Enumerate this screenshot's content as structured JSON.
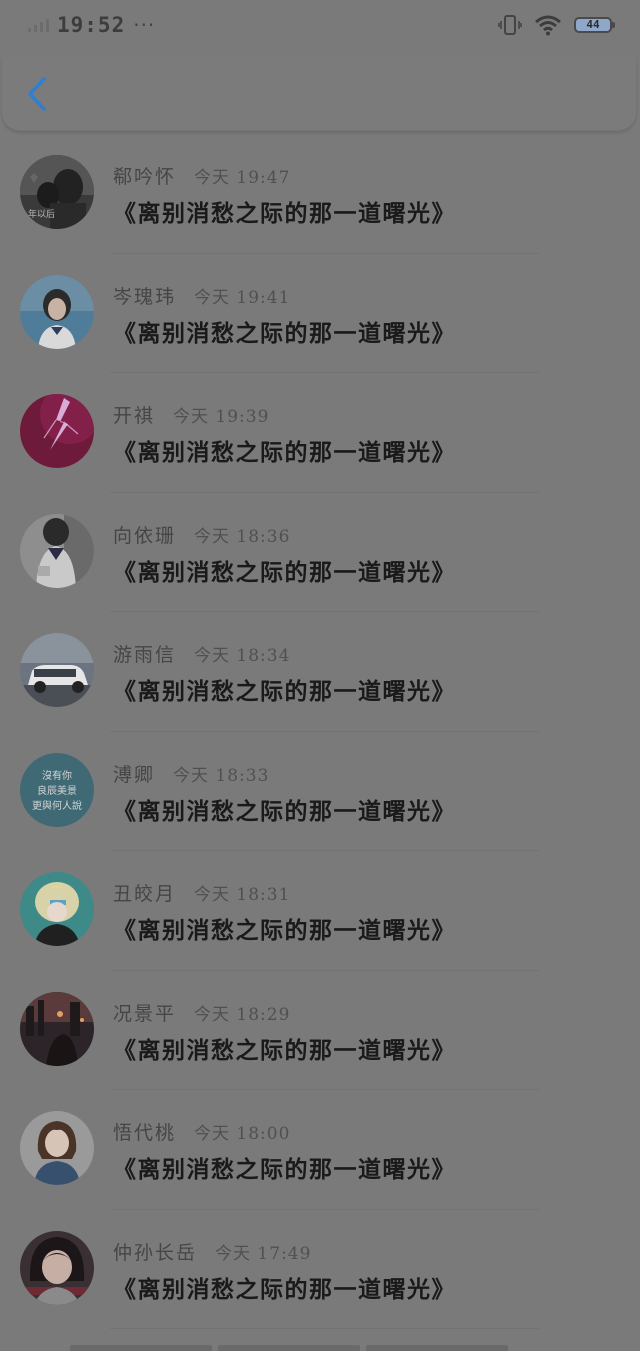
{
  "status_bar": {
    "time": "19:52",
    "more_dots": "···",
    "battery_level": "44"
  },
  "header": {
    "back_icon": "chevron-left-icon",
    "accent_color": "#2f7fd0"
  },
  "messages": [
    {
      "name": "郗吟怀",
      "time": "今天 19:47",
      "text": "《离别消愁之际的那一道曙光》",
      "avatar_icon": "avatar-couple-dark"
    },
    {
      "name": "岑瑰玮",
      "time": "今天 19:41",
      "text": "《离别消愁之际的那一道曙光》",
      "avatar_icon": "avatar-girl-blue"
    },
    {
      "name": "开祺",
      "time": "今天 19:39",
      "text": "《离别消愁之际的那一道曙光》",
      "avatar_icon": "avatar-lightning-magenta"
    },
    {
      "name": "向依珊",
      "time": "今天 18:36",
      "text": "《离别消愁之际的那一道曙光》",
      "avatar_icon": "avatar-girl-uniform"
    },
    {
      "name": "游雨信",
      "time": "今天 18:34",
      "text": "《离别消愁之际的那一道曙光》",
      "avatar_icon": "avatar-white-car"
    },
    {
      "name": "溥卿",
      "time": "今天 18:33",
      "text": "《离别消愁之际的那一道曙光》",
      "avatar_icon": "avatar-text-teal"
    },
    {
      "name": "丑皎月",
      "time": "今天 18:31",
      "text": "《离别消愁之际的那一道曙光》",
      "avatar_icon": "avatar-anime-teal"
    },
    {
      "name": "况景平",
      "time": "今天 18:29",
      "text": "《离别消愁之际的那一道曙光》",
      "avatar_icon": "avatar-city-night"
    },
    {
      "name": "悟代桃",
      "time": "今天 18:00",
      "text": "《离别消愁之际的那一道曙光》",
      "avatar_icon": "avatar-girl-bob"
    },
    {
      "name": "仲孙长岳",
      "time": "今天 17:49",
      "text": "《离别消愁之际的那一道曙光》",
      "avatar_icon": "avatar-girl-dark"
    }
  ],
  "avatar_texts": {
    "first": "年以后",
    "teal": [
      "沒有你",
      "良辰美景",
      "更與何人說"
    ]
  }
}
